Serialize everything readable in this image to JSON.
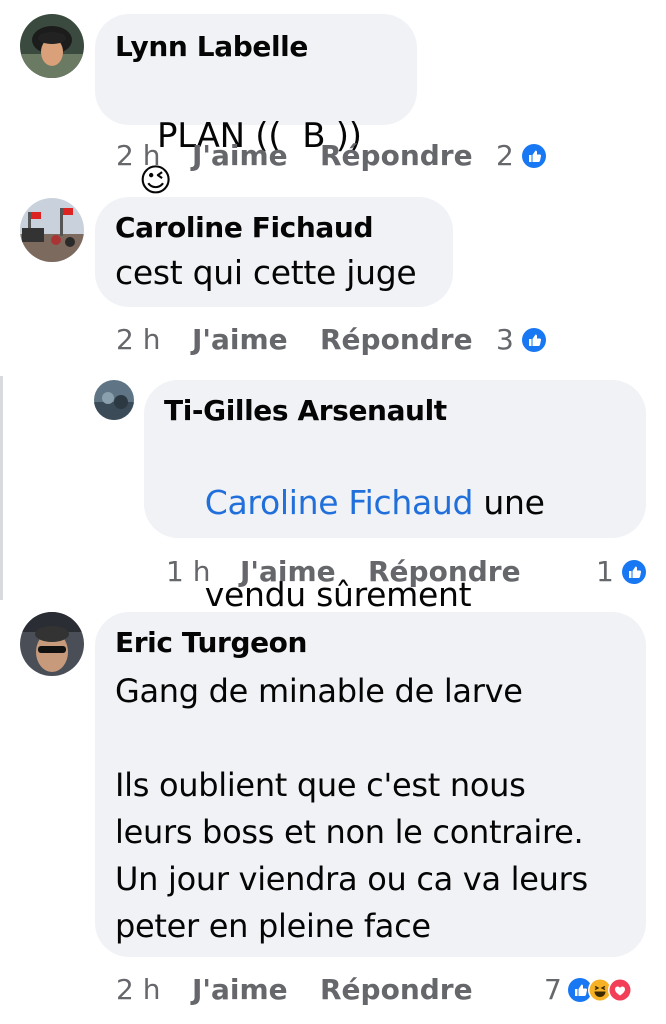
{
  "comments": [
    {
      "author": "Lynn Labelle",
      "text": "PLAN ((  B ))",
      "emoji": "😉",
      "time": "2 h",
      "like": "J'aime",
      "reply": "Répondre",
      "reactions": "2",
      "reaction_icons": [
        "like-icon"
      ]
    },
    {
      "author": "Caroline Fichaud",
      "text": "cest qui cette juge",
      "time": "2 h",
      "like": "J'aime",
      "reply": "Répondre",
      "reactions": "3",
      "reaction_icons": [
        "like-icon"
      ]
    },
    {
      "author": "Ti-Gilles Arsenault",
      "mention": "Caroline Fichaud",
      "text_line1_rest": " une",
      "text_line2": "vendu sûrement",
      "time": "1 h",
      "like": "J'aime",
      "reply": "Répondre",
      "reactions": "1",
      "reaction_icons": [
        "like-icon"
      ]
    },
    {
      "author": "Eric Turgeon",
      "text": "Gang de minable de larve\n\nIls oublient que c'est nous\nleurs boss et non le contraire.\nUn jour viendra ou ca va leurs\npeter en pleine face",
      "time": "2 h",
      "like": "J'aime",
      "reply": "Répondre",
      "reactions": "7",
      "reaction_icons": [
        "like-icon",
        "haha-icon",
        "love-icon"
      ]
    }
  ],
  "colors": {
    "bubble": "#f0f2f5",
    "mention": "#216fdb",
    "meta": "#65676b",
    "like": "#1877f2",
    "love": "#f33e58",
    "haha": "#f7b125"
  }
}
